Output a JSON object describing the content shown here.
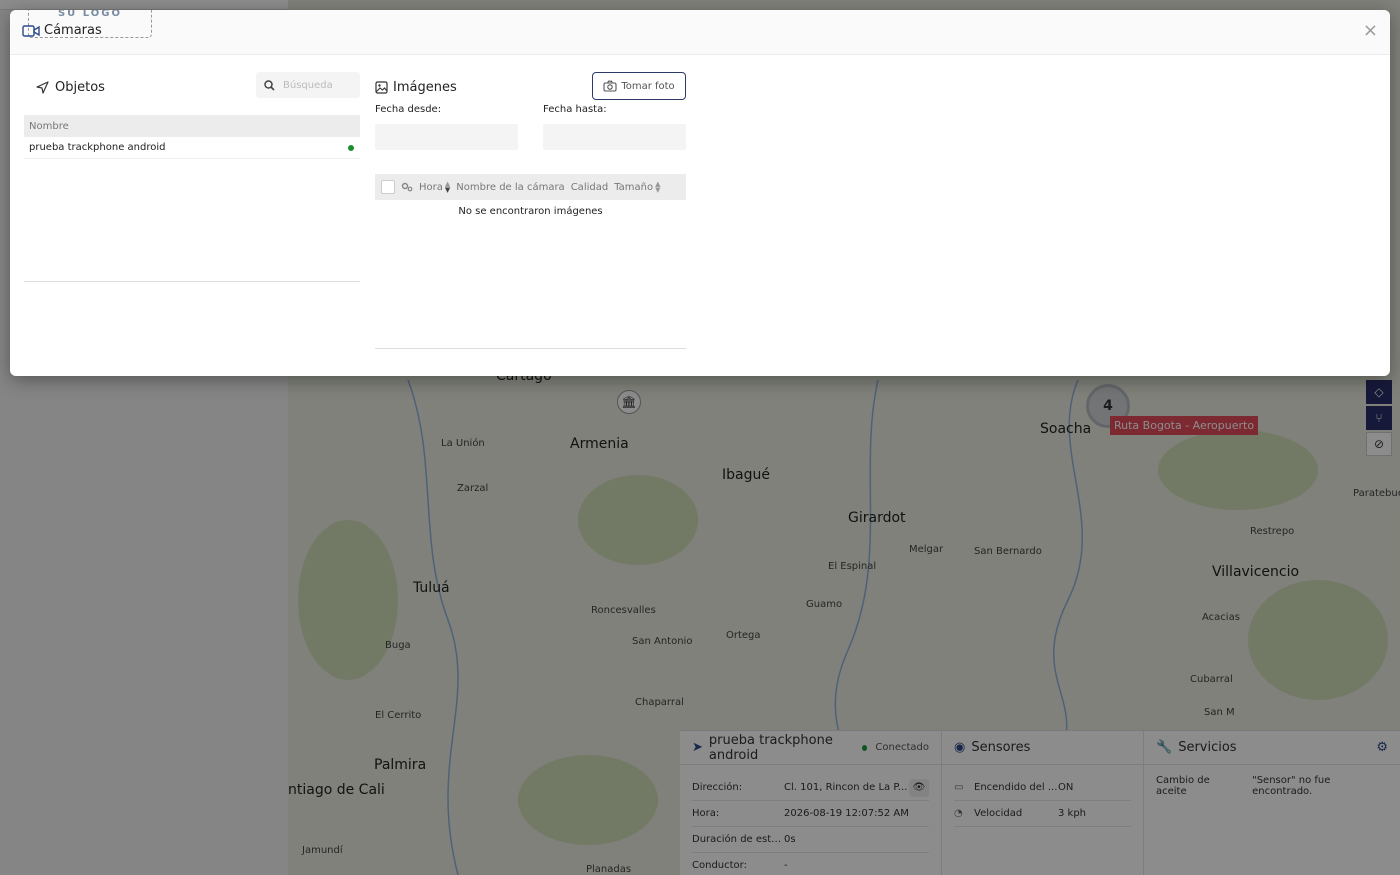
{
  "modal": {
    "logo_text": "SU LOGO",
    "title": "Cámaras",
    "close_label": "×"
  },
  "objects": {
    "title": "Objetos",
    "search_placeholder": "Búsqueda",
    "column_name": "Nombre",
    "items": [
      {
        "name": "prueba trackphone android",
        "status": "online"
      }
    ]
  },
  "images": {
    "title": "Imágenes",
    "take_photo_label": "Tomar foto",
    "date_from_label": "Fecha desde:",
    "date_to_label": "Fecha hasta:",
    "date_from_value": "",
    "date_to_value": "",
    "columns": [
      "Hora",
      "Nombre de la cámara",
      "Calidad",
      "Tamaño"
    ],
    "empty_message": "No se encontraron imágenes"
  },
  "map": {
    "cities_big": [
      "Cartago",
      "Armenia",
      "Ibagué",
      "Soacha",
      "Girardot",
      "Villavicencio",
      "Tuluá",
      "Palmira",
      "ntiago de Cali"
    ],
    "cities_small": [
      "La Unión",
      "Zarzal",
      "Melgar",
      "San Bernardo",
      "El Espinal",
      "Restrepo",
      "Paratebue",
      "Roncesvalles",
      "Guamo",
      "San Antonio",
      "Ortega",
      "Acacias",
      "Buga",
      "Chaparral",
      "Cubarral",
      "El Cerrito",
      "San M",
      "Jamundí",
      "Planadas"
    ],
    "cluster_count": "4",
    "route_label": "Ruta Bogota - Aeropuerto"
  },
  "info_panel": {
    "device": {
      "name": "prueba trackphone android",
      "status": "Conectado",
      "rows": [
        {
          "key": "Dirección:",
          "value": "Cl. 101, Rincon de La P..."
        },
        {
          "key": "Hora:",
          "value": "2026-08-19 12:07:52 AM"
        },
        {
          "key": "Duración de esta...",
          "value": "0s"
        },
        {
          "key": "Conductor:",
          "value": "-"
        }
      ]
    },
    "sensors": {
      "title": "Sensores",
      "rows": [
        {
          "key": "Encendido del ...",
          "value": "ON"
        },
        {
          "key": "Velocidad",
          "value": "3 kph"
        }
      ]
    },
    "services": {
      "title": "Servicios",
      "row_key": "Cambio de aceite",
      "row_value": "\"Sensor\" no fue encontrado."
    }
  },
  "colors": {
    "accent": "#2b4a8b",
    "online": "#1a8f2e",
    "route_label": "#e34b5b"
  }
}
